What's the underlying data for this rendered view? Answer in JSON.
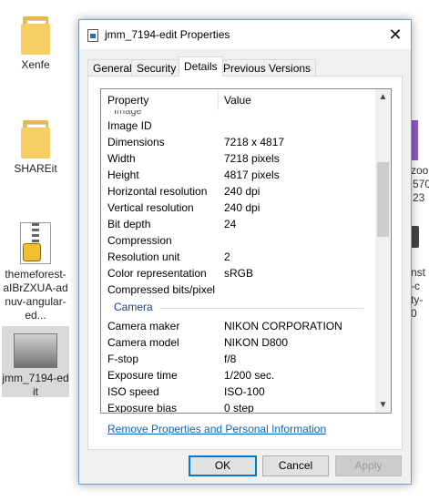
{
  "desktop": {
    "icons": [
      {
        "label": "Xenfe"
      },
      {
        "label": "SHAREit"
      },
      {
        "label": "themeforest-aIBrZXUA-adnuv-angular-ed..."
      },
      {
        "label": "jmm_7194-edit"
      }
    ],
    "right_edge_fragments": [
      "zoo",
      "570",
      "23",
      "nst",
      "-c",
      "ty-",
      "0"
    ]
  },
  "dialog": {
    "title": "jmm_7194-edit Properties",
    "close_glyph": "✕",
    "tabs": [
      "General",
      "Security",
      "Details",
      "Previous Versions"
    ],
    "active_tab": "Details",
    "columns": {
      "property": "Property",
      "value": "Value"
    },
    "peek_group": "Image",
    "rows_top": [
      {
        "property": "Image ID",
        "value": ""
      },
      {
        "property": "Dimensions",
        "value": "7218 x 4817"
      },
      {
        "property": "Width",
        "value": "7218 pixels"
      },
      {
        "property": "Height",
        "value": "4817 pixels"
      },
      {
        "property": "Horizontal resolution",
        "value": "240 dpi"
      },
      {
        "property": "Vertical resolution",
        "value": "240 dpi"
      },
      {
        "property": "Bit depth",
        "value": "24"
      },
      {
        "property": "Compression",
        "value": ""
      },
      {
        "property": "Resolution unit",
        "value": "2"
      },
      {
        "property": "Color representation",
        "value": "sRGB"
      },
      {
        "property": "Compressed bits/pixel",
        "value": ""
      }
    ],
    "group_camera": "Camera",
    "rows_camera": [
      {
        "property": "Camera maker",
        "value": "NIKON CORPORATION"
      },
      {
        "property": "Camera model",
        "value": "NIKON D800"
      },
      {
        "property": "F-stop",
        "value": "f/8"
      },
      {
        "property": "Exposure time",
        "value": "1/200 sec."
      },
      {
        "property": "ISO speed",
        "value": "ISO-100"
      },
      {
        "property": "Exposure bias",
        "value": "0 step"
      }
    ],
    "remove_link": "Remove Properties and Personal Information",
    "buttons": {
      "ok": "OK",
      "cancel": "Cancel",
      "apply": "Apply"
    },
    "accent_color": "#0078d7"
  }
}
